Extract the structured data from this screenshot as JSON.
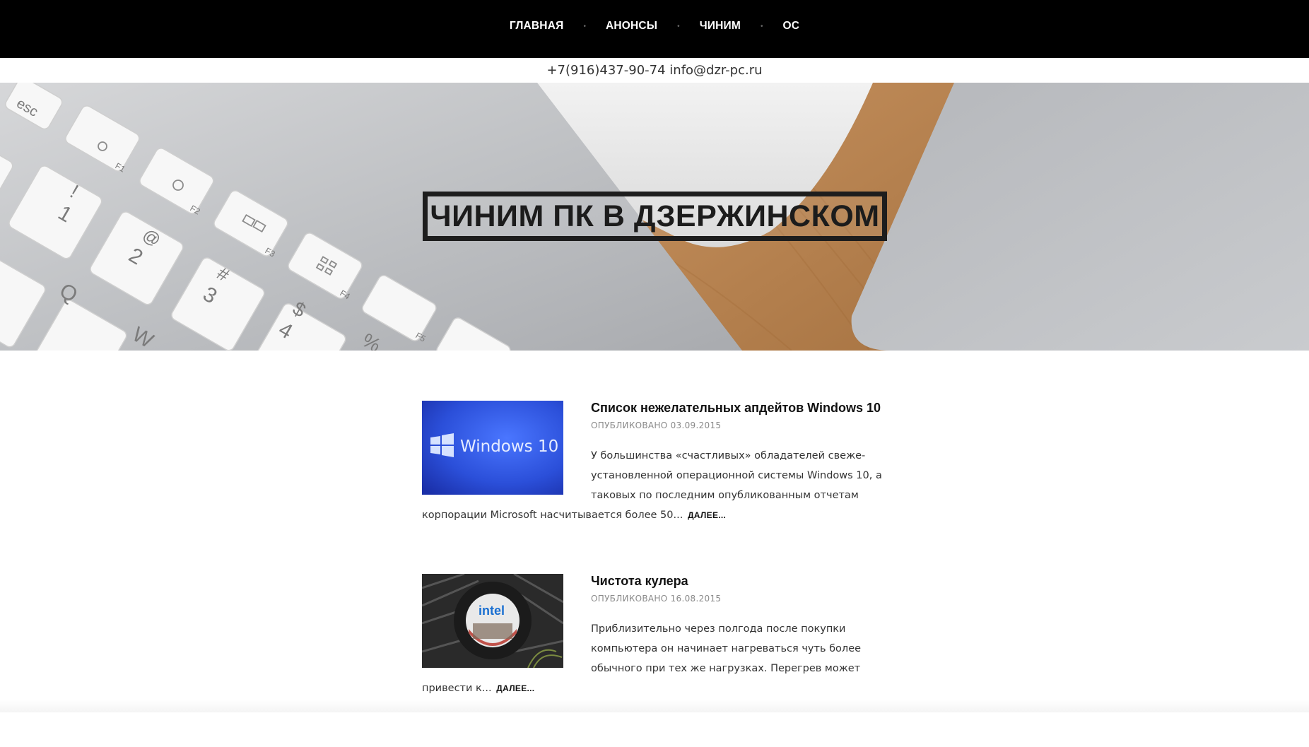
{
  "nav": {
    "items": [
      {
        "label": "ГЛАВНАЯ"
      },
      {
        "label": "АНОНСЫ"
      },
      {
        "label": "ЧИНИМ"
      },
      {
        "label": "ОС"
      }
    ],
    "separator": "•"
  },
  "contact": {
    "phone": "+7(916)437-90-74",
    "email": "info@dzr-pc.ru"
  },
  "hero": {
    "title": "ЧИНИМ ПК В ДЗЕРЖИНСКОМ",
    "keys": {
      "esc": "esc",
      "f1": "F1",
      "f2": "F2",
      "f3": "F3",
      "f4": "F4",
      "f5": "F5",
      "k1_top": "!",
      "k1": "1",
      "k2_top": "@",
      "k2": "2",
      "k3_top": "#",
      "k3": "3",
      "k4_top": "$",
      "k4": "4",
      "k5_top": "%",
      "q": "Q",
      "w": "W"
    }
  },
  "posts": [
    {
      "title": "Список нежелательных апдейтов Windows 10",
      "meta": "ОПУБЛИКОВАНО 03.09.2015",
      "thumb_text": "Windows 10",
      "excerpt_lines": [
        "У большинства «счастливых» обладателей свеже-",
        "установленной операционной системы Windows 10, а",
        "таковых по последним опубликованным отчетам"
      ],
      "excerpt_last": "корпорации Microsoft насчитывается более 50...",
      "more": "ДАЛЕЕ..."
    },
    {
      "title": "Чистота кулера",
      "meta": "ОПУБЛИКОВАНО 16.08.2015",
      "thumb_text": "intel",
      "excerpt_lines": [
        "Приблизительно через полгода после покупки",
        "компьютера он начинает нагреваться чуть более",
        "обычного при тех же нагрузках. Перегрев может"
      ],
      "excerpt_last": "привести к...",
      "more": "ДАЛЕЕ..."
    }
  ],
  "colors": {
    "nav_bg": "#000000",
    "windows_blue": "#2b4fd9",
    "wood": "#b07a48"
  }
}
